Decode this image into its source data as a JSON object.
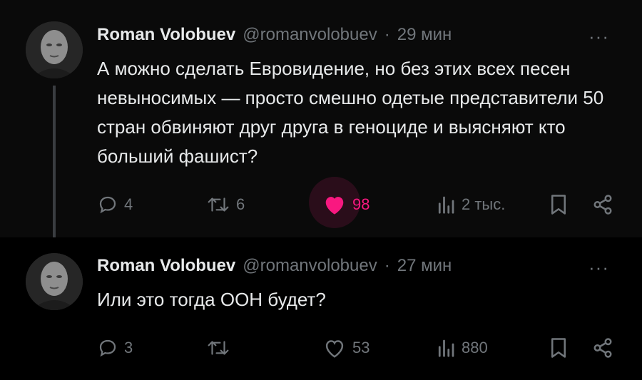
{
  "tweets": [
    {
      "author_name": "Roman Volobuev",
      "handle": "@romanvolobuev",
      "separator": "·",
      "time": "29 мин",
      "text": "А можно сделать Евровидение, но без этих всех песен невыносимых — просто смешно одетые представители 50 стран обвиняют друг друга в геноциде и выясняют кто больший фашист?",
      "stats": {
        "replies": "4",
        "reposts": "6",
        "likes": "98",
        "views": "2 тыс."
      },
      "liked": true
    },
    {
      "author_name": "Roman Volobuev",
      "handle": "@romanvolobuev",
      "separator": "·",
      "time": "27 мин",
      "text": "Или это тогда ООН будет?",
      "stats": {
        "replies": "3",
        "reposts": "",
        "likes": "53",
        "views": "880"
      },
      "liked": false
    }
  ],
  "icons": {
    "reply": "reply-icon",
    "repost": "repost-icon",
    "like": "heart-icon",
    "views": "views-icon",
    "bookmark": "bookmark-icon",
    "share": "share-icon",
    "more": "more-icon"
  },
  "colors": {
    "background": "#000000",
    "text": "#e7e9ea",
    "muted": "#71767b",
    "like": "#f91880"
  }
}
